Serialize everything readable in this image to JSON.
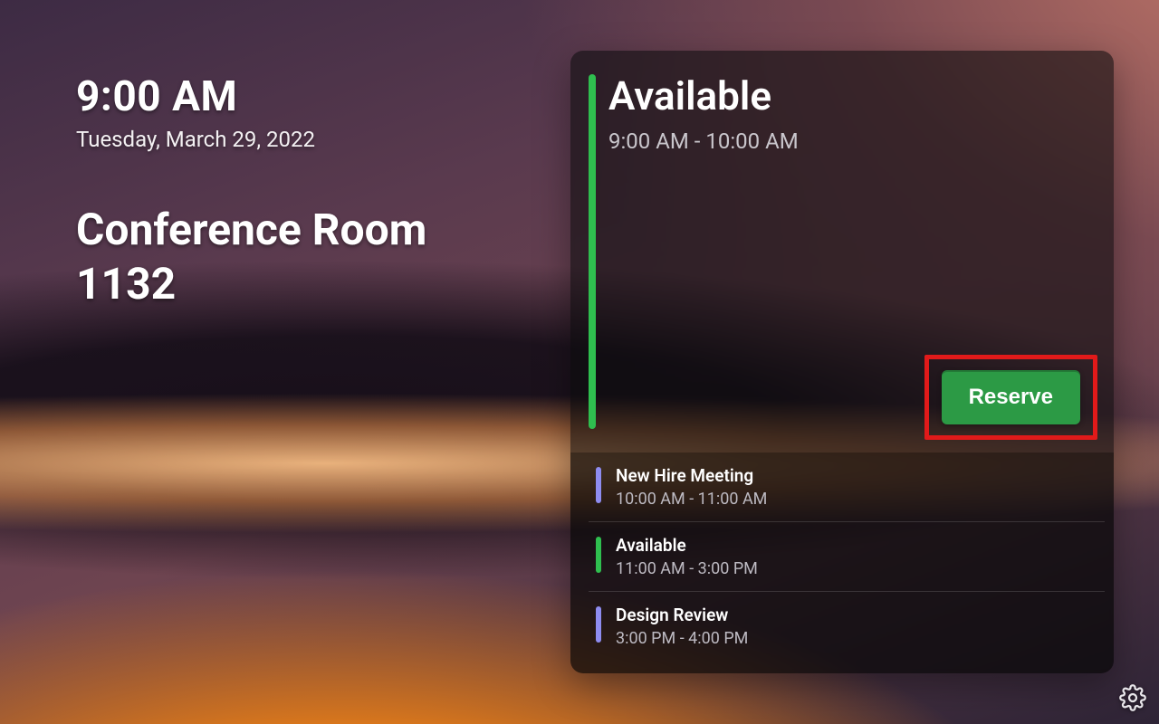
{
  "clock": {
    "time": "9:00 AM",
    "date": "Tuesday, March 29, 2022"
  },
  "room": {
    "name": "Conference Room 1132"
  },
  "current": {
    "status": "Available",
    "time_range": "9:00 AM - 10:00 AM",
    "accent_color": "#2fbf4f",
    "reserve_label": "Reserve"
  },
  "upcoming": [
    {
      "title": "New Hire Meeting",
      "time_range": "10:00 AM - 11:00 AM",
      "accent": "purple"
    },
    {
      "title": "Available",
      "time_range": "11:00 AM - 3:00 PM",
      "accent": "green"
    },
    {
      "title": "Design Review",
      "time_range": "3:00 PM - 4:00 PM",
      "accent": "purple"
    }
  ],
  "highlight": {
    "target": "reserve-button",
    "outline_color": "#e11a1a"
  }
}
